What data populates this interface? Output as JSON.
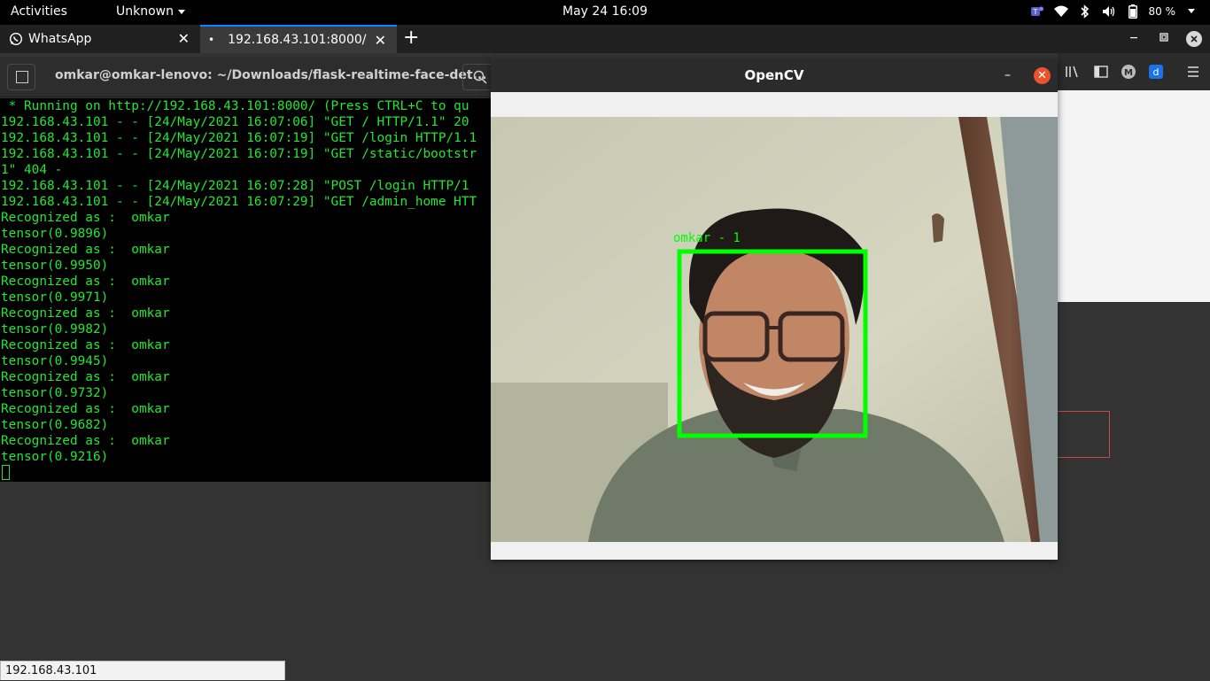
{
  "topbar": {
    "activities": "Activities",
    "app_menu": "Unknown",
    "clock": "May 24  16:09",
    "battery": "80 %"
  },
  "browser": {
    "tabs": [
      {
        "label": "WhatsApp",
        "close": "✕"
      },
      {
        "label": "192.168.43.101:8000/",
        "indicator": "•",
        "close": "✕"
      }
    ],
    "new_tab": "+",
    "status_url": "192.168.43.101"
  },
  "terminal": {
    "title": "omkar@omkar-lenovo: ~/Downloads/flask-realtime-face-det...",
    "lines": [
      " * Running on http://192.168.43.101:8000/ (Press CTRL+C to qu",
      "192.168.43.101 - - [24/May/2021 16:07:06] \"GET / HTTP/1.1\" 20",
      "192.168.43.101 - - [24/May/2021 16:07:19] \"GET /login HTTP/1.1",
      "192.168.43.101 - - [24/May/2021 16:07:19] \"GET /static/bootstr",
      "1\" 404 -",
      "192.168.43.101 - - [24/May/2021 16:07:28] \"POST /login HTTP/1",
      "192.168.43.101 - - [24/May/2021 16:07:29] \"GET /admin_home HTT",
      "Recognized as :  omkar",
      "tensor(0.9896)",
      "Recognized as :  omkar",
      "tensor(0.9950)",
      "Recognized as :  omkar",
      "tensor(0.9971)",
      "Recognized as :  omkar",
      "tensor(0.9982)",
      "Recognized as :  omkar",
      "tensor(0.9945)",
      "Recognized as :  omkar",
      "tensor(0.9732)",
      "Recognized as :  omkar",
      "tensor(0.9682)",
      "Recognized as :  omkar",
      "tensor(0.9216)"
    ]
  },
  "opencv": {
    "title": "OpenCV",
    "minimize": "–",
    "close": "✕",
    "face_label": "omkar - 1",
    "box_color": "#00ff00"
  }
}
